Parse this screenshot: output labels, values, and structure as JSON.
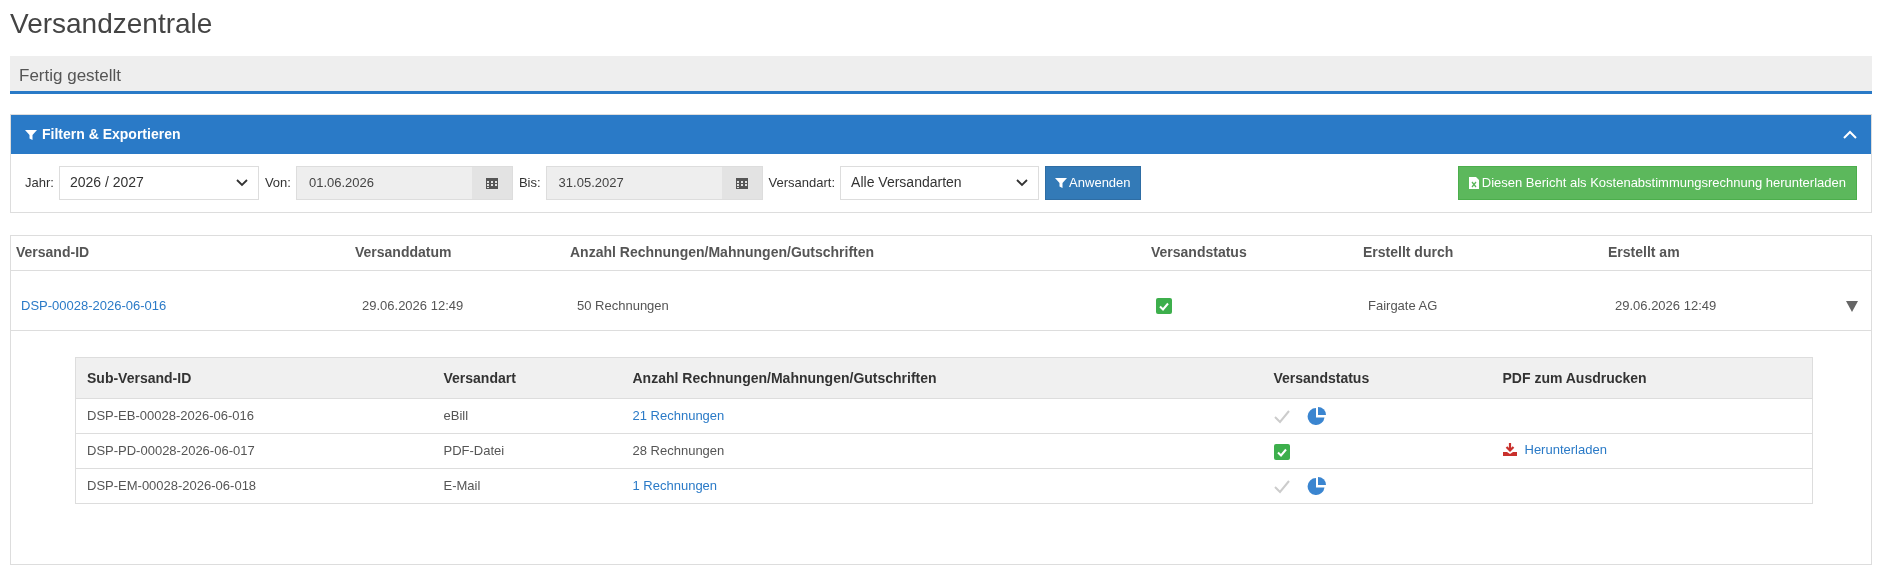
{
  "page_title": "Versandzentrale",
  "section_title": "Fertig gestellt",
  "filter_panel": {
    "title": "Filtern & Exportieren",
    "expanded": true,
    "year": {
      "label": "Jahr:",
      "value": "2026 / 2027"
    },
    "from": {
      "label": "Von:",
      "value": "01.06.2026"
    },
    "to": {
      "label": "Bis:",
      "value": "31.05.2027"
    },
    "dispatch_type": {
      "label": "Versandart:",
      "value": "Alle Versandarten"
    },
    "apply_button": "Anwenden",
    "export_button": "Diesen Bericht als Kostenabstimmungsrechnung herunterladen"
  },
  "table": {
    "columns": [
      "Versand-ID",
      "Versanddatum",
      "Anzahl Rechnungen/Mahnungen/Gutschriften",
      "Versandstatus",
      "Erstellt durch",
      "Erstellt am"
    ],
    "rows": [
      {
        "id": "DSP-00028-2026-06-016",
        "date": "29.06.2026 12:49",
        "count": "50 Rechnungen",
        "sent": true,
        "created_by": "Fairgate AG",
        "created_at": "29.06.2026 12:49",
        "expanded": true,
        "sub_table": {
          "columns": [
            "Sub-Versand-ID",
            "Versandart",
            "Anzahl Rechnungen/Mahnungen/Gutschriften",
            "Versandstatus",
            "PDF zum Ausdrucken"
          ],
          "rows": [
            {
              "id": "DSP-EB-00028-2026-06-016",
              "type": "eBill",
              "count": "21 Rechnungen",
              "count_link": true,
              "sent": false
            },
            {
              "id": "DSP-PD-00028-2026-06-017",
              "type": "PDF-Datei",
              "count": "28 Rechnungen",
              "count_link": false,
              "sent": true,
              "pdf": "Herunterladen"
            },
            {
              "id": "DSP-EM-00028-2026-06-018",
              "type": "E-Mail",
              "count": "1 Rechnungen",
              "count_link": true,
              "sent": false
            }
          ]
        }
      }
    ]
  }
}
